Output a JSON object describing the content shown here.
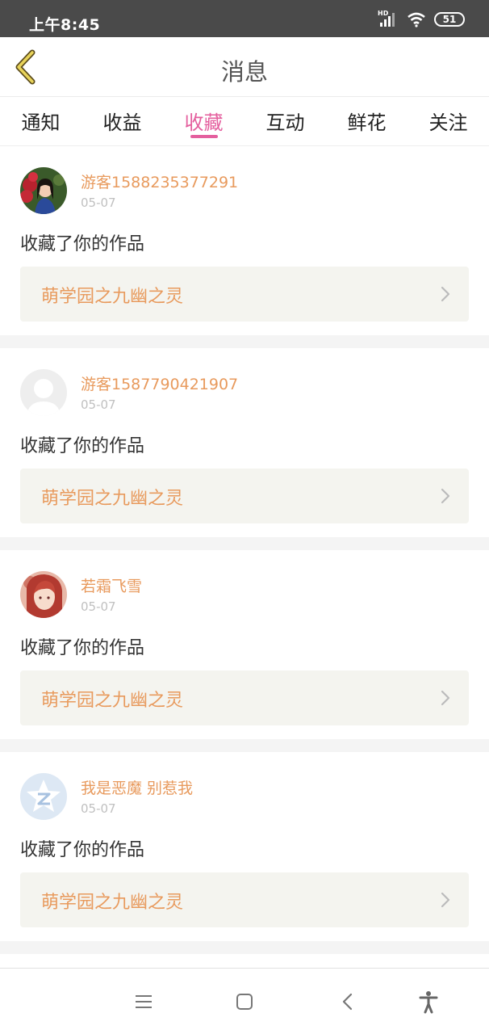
{
  "status_bar": {
    "time": "上午8:45",
    "network_badge": "HD",
    "battery_level": "51",
    "icons": [
      "signal-icon",
      "wifi-icon",
      "battery-icon"
    ]
  },
  "header": {
    "title": "消息",
    "back_icon": "chevron-left-icon"
  },
  "tabs": [
    {
      "label": "通知",
      "active": false
    },
    {
      "label": "收益",
      "active": false
    },
    {
      "label": "收藏",
      "active": true
    },
    {
      "label": "互动",
      "active": false
    },
    {
      "label": "鲜花",
      "active": false
    },
    {
      "label": "关注",
      "active": false
    }
  ],
  "items": [
    {
      "username": "游客1588235377291",
      "date": "05-07",
      "action": "收藏了你的作品",
      "work": "萌学园之九幽之灵",
      "avatar_icon": "photo-avatar-icon"
    },
    {
      "username": "游客1587790421907",
      "date": "05-07",
      "action": "收藏了你的作品",
      "work": "萌学园之九幽之灵",
      "avatar_icon": "default-avatar-icon"
    },
    {
      "username": "若霜飞雪",
      "date": "05-07",
      "action": "收藏了你的作品",
      "work": "萌学园之九幽之灵",
      "avatar_icon": "anime-avatar-icon"
    },
    {
      "username": "我是恶魔 别惹我",
      "date": "05-07",
      "action": "收藏了你的作品",
      "work": "萌学园之九幽之灵",
      "avatar_icon": "qzone-star-avatar-icon"
    }
  ],
  "nav_bar": {
    "icons": [
      "menu-icon",
      "home-icon",
      "back-icon",
      "accessibility-icon"
    ]
  },
  "colors": {
    "accent": "#e45f9e",
    "name_orange": "#e89a5d",
    "status_bar": "#4a4a4a",
    "card_box": "#f4f4ef"
  }
}
